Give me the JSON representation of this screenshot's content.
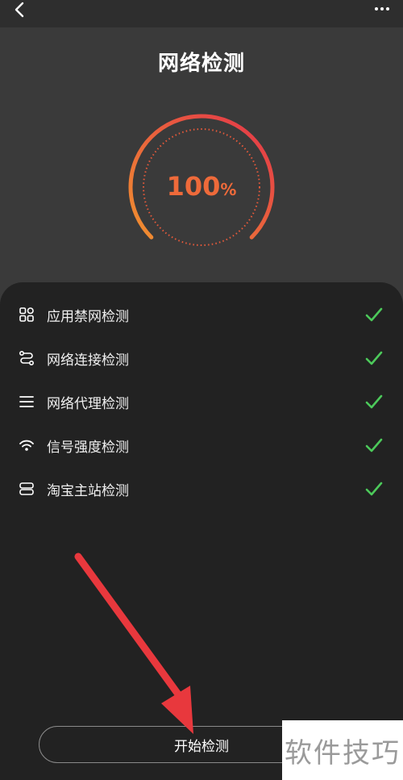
{
  "header": {
    "title": "网络检测",
    "back_icon": "back-chevron-icon",
    "more_icon": "more-dots-icon"
  },
  "gauge": {
    "value": "100",
    "unit": "%",
    "progress": 1.0,
    "colors": {
      "start": "#f0902f",
      "end": "#e3344a",
      "text": "#ee6a3a"
    }
  },
  "checks": {
    "items": [
      {
        "label": "应用禁网检测",
        "icon": "apps-grid-icon",
        "status": "passed"
      },
      {
        "label": "网络连接检测",
        "icon": "connection-route-icon",
        "status": "passed"
      },
      {
        "label": "网络代理检测",
        "icon": "menu-lines-icon",
        "status": "passed"
      },
      {
        "label": "信号强度检测",
        "icon": "wifi-icon",
        "status": "passed"
      },
      {
        "label": "淘宝主站检测",
        "icon": "server-icon",
        "status": "passed"
      }
    ],
    "check_color": "#4cc95a"
  },
  "footer": {
    "start_label": "开始检测"
  },
  "annotation": {
    "color": "#e8383d"
  },
  "watermark": {
    "text": "软件技巧"
  }
}
